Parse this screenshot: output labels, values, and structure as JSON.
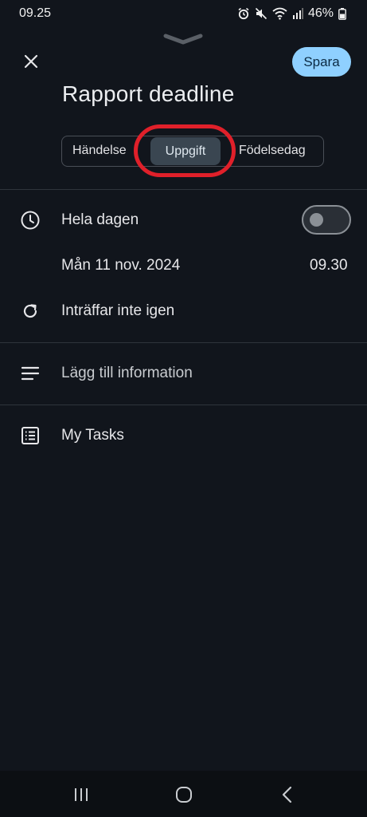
{
  "status_bar": {
    "time": "09.25",
    "battery": "46%",
    "icons": [
      "alarm-icon",
      "mute-icon",
      "wifi-icon",
      "signal-icon",
      "battery-icon"
    ]
  },
  "header": {
    "handle_icon": "chevron-down-icon",
    "close_icon": "close-icon",
    "save_label": "Spara"
  },
  "title": "Rapport deadline",
  "type_selector": {
    "options": [
      "Händelse",
      "Uppgift",
      "Födelsedag"
    ],
    "selected": "Uppgift"
  },
  "all_day": {
    "label": "Hela dagen",
    "enabled": false
  },
  "date": "Mån 11 nov. 2024",
  "time": "09.30",
  "repeat": "Inträffar inte igen",
  "details_placeholder": "Lägg till information",
  "task_list": "My Tasks",
  "colors": {
    "background": "#11151c",
    "accent": "#8fd0ff",
    "selected_segment": "#3a4651",
    "highlight_ring": "#e0202a"
  }
}
